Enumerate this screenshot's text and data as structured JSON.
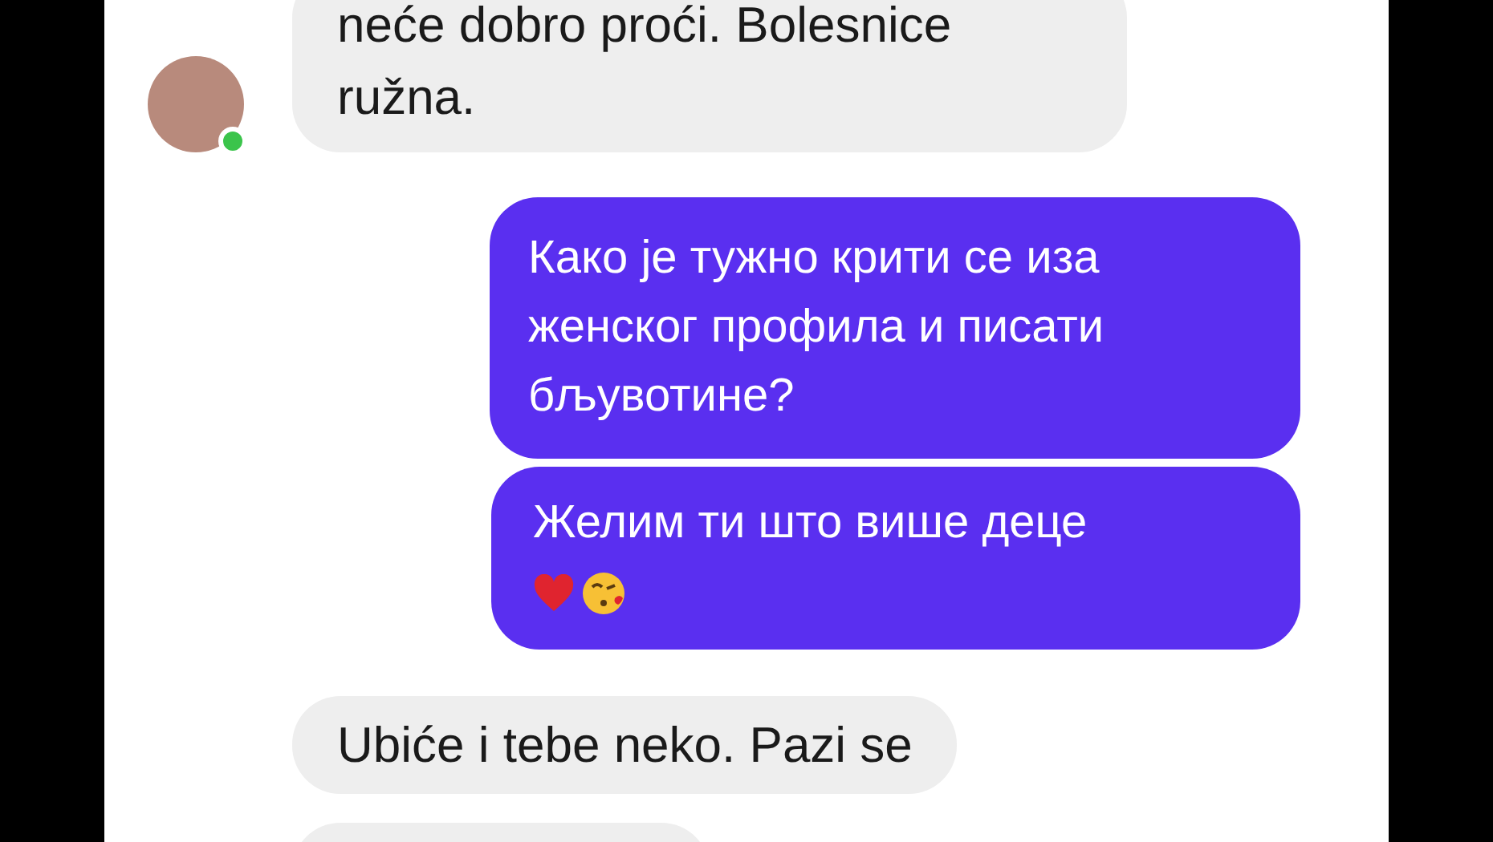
{
  "messages": [
    {
      "kind": "incoming",
      "text": "neće dobro proći. Bolesnice ružna.",
      "avatar": {
        "online": true
      }
    },
    {
      "kind": "outgoing",
      "text": "Како је тужно крити се иза женског профила и писати бљувотине?"
    },
    {
      "kind": "outgoing",
      "text": "Желим ти што више деце",
      "emoji": [
        {
          "kind": "heart"
        },
        {
          "kind": "kissing-face"
        }
      ]
    },
    {
      "kind": "incoming",
      "text": "Ubiće i tebe neko. Pazi se"
    },
    {
      "kind": "incoming"
    }
  ]
}
